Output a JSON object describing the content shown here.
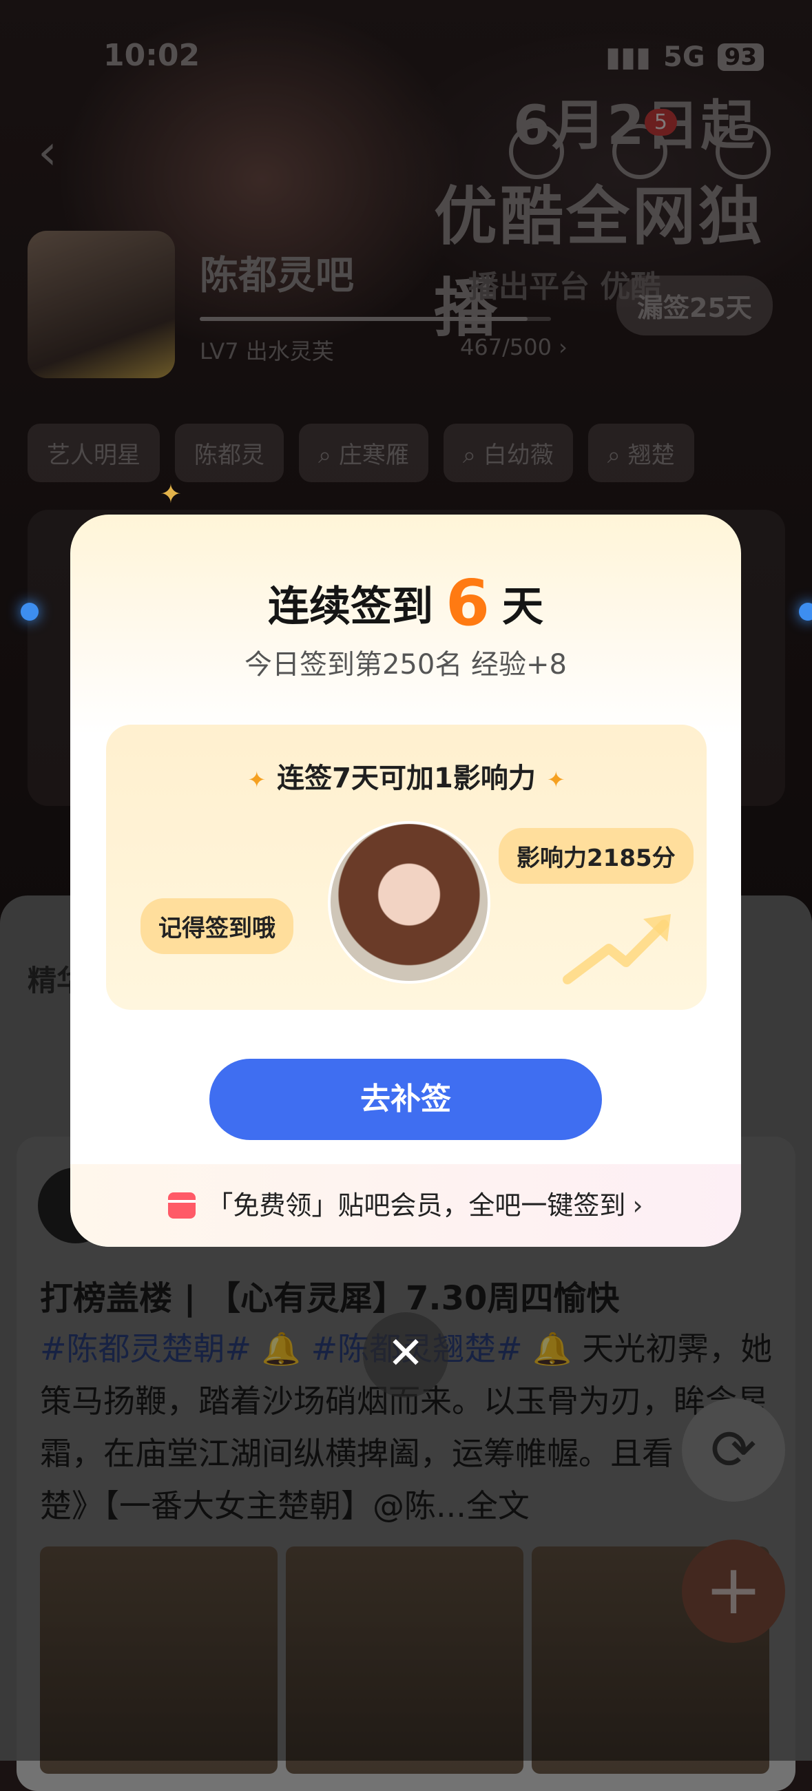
{
  "status_bar": {
    "time": "10:02",
    "network": "5G",
    "battery": "93"
  },
  "header": {
    "promo_line1": "6月2日起",
    "promo_line2": "优酷全网独播",
    "platform": "播出平台 优酷",
    "notification_count": "5",
    "forum_name": "陈都灵吧",
    "level": "LV7 出水灵芙",
    "level_progress": "467/500",
    "level_progress_fraction": 0.934,
    "missed_checkin": "漏签25天"
  },
  "tags": [
    "艺人明星",
    "陈都灵",
    "庄寒雁",
    "白幼薇",
    "翘楚"
  ],
  "feed": {
    "section_label": "精华",
    "post": {
      "title": "打榜盖楼 | 【心有灵犀】7.30周四愉快",
      "hashtag1": "#陈都灵楚朝#",
      "hashtag2": "#陈都灵翘楚#",
      "body": "天光初霁，她策马扬鞭，踏着沙场硝烟而来。以玉骨为刃，眸含星霜，在庙堂江湖间纵横捭阖，运筹帷幄。且看《翘楚》【一番大女主楚朝】@陈...全文"
    }
  },
  "modal": {
    "title_prefix": "连续签到",
    "streak_days": "6",
    "title_suffix": "天",
    "subtitle": "今日签到第250名 经验+8",
    "reward_headline": "连签7天可加1影响力",
    "bubble_left": "记得签到哦",
    "bubble_right": "影响力2185分",
    "cta_label": "去补签",
    "vip_text": "「免费领」贴吧会员，全吧一键签到",
    "accent_color": "#ff7a12",
    "button_color": "#3f6ef1"
  }
}
